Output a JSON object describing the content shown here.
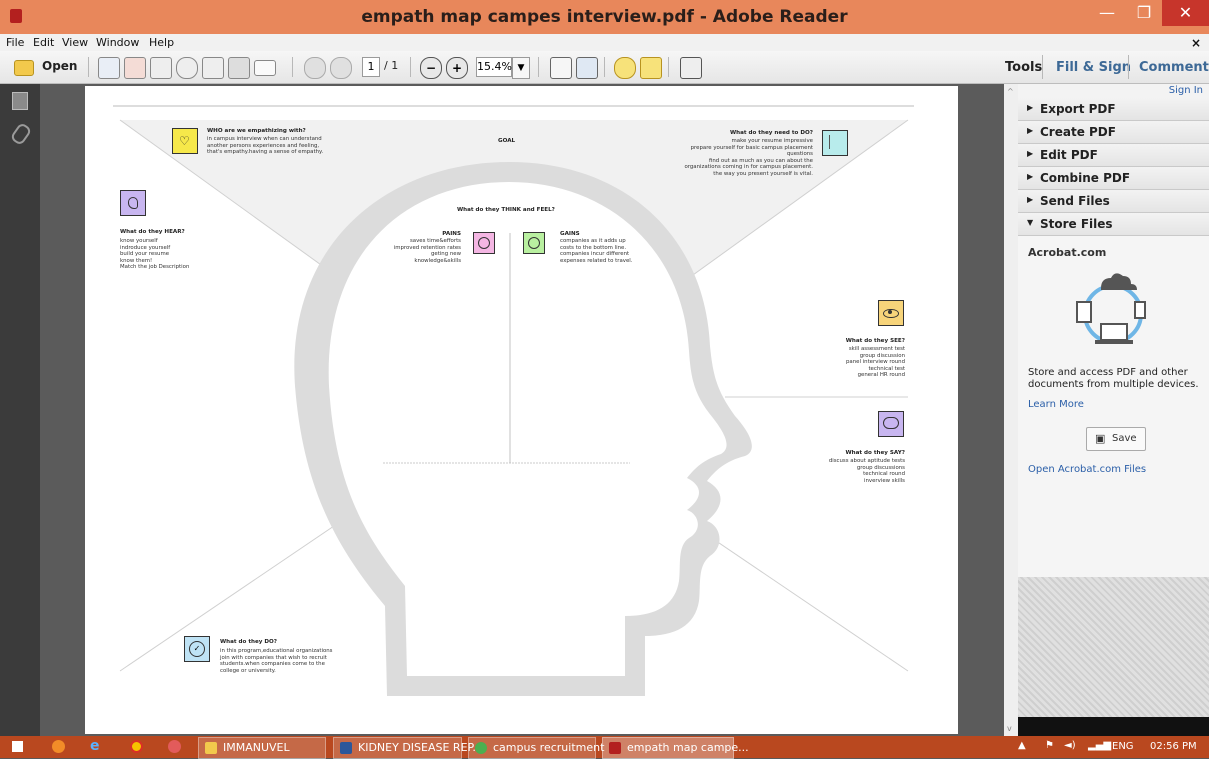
{
  "window": {
    "title": "empath map campes interview.pdf - Adobe Reader",
    "buttons": {
      "minimize": "—",
      "maximize": "❐",
      "close": "✕"
    }
  },
  "menu": [
    "File",
    "Edit",
    "View",
    "Window",
    "Help"
  ],
  "menu_close": "×",
  "toolbar": {
    "open_label": "Open",
    "page_current": "1",
    "page_total": "/ 1",
    "zoom": "15.4%",
    "tools_label": "Tools",
    "fill_sign_label": "Fill & Sign",
    "comment_label": "Comment"
  },
  "right_pane": {
    "sign_in": "Sign In",
    "panels": [
      "Export PDF",
      "Create PDF",
      "Edit PDF",
      "Combine PDF",
      "Send Files",
      "Store Files"
    ],
    "store": {
      "site": "Acrobat.com",
      "description": "Store and access PDF and other documents from multiple devices.",
      "learn_more": "Learn More",
      "save_label": "Save",
      "open_files": "Open Acrobat.com Files"
    }
  },
  "document": {
    "goal": "GOAL",
    "who": {
      "heading": "WHO are we empathizing with?",
      "lines": [
        "in campus interview when can understand",
        "another persons experiences and feeling,",
        "that's empathy.having a sense of empathy."
      ]
    },
    "do_need": {
      "heading": "What do they need to DO?",
      "lines": [
        "make your resume impressive",
        "prepare yourself for basic campus placement",
        "questions",
        "find out as much as  you can about the",
        "organizations coming in for campus placement.",
        "the way you  present  yourself is vital."
      ]
    },
    "hear": {
      "heading": "What do they HEAR?",
      "lines": [
        "know yourself",
        "indroduce  yourself",
        "build your resume",
        "know them!",
        "Match the job Description"
      ]
    },
    "think_feel": "What do they THINK and FEEL?",
    "pains": {
      "heading": "PAINS",
      "lines": [
        "saves time&efforts",
        "improved retention rates",
        "geting new",
        "knowledge&skills"
      ]
    },
    "gains": {
      "heading": "GAINS",
      "lines": [
        "companies as it adds up",
        "costs to the bottom line.",
        "companies incur different",
        "expenses related to travel."
      ]
    },
    "see": {
      "heading": "What do they SEE?",
      "lines": [
        "skill assessment test",
        "group discussion",
        "panel interview round",
        "technical test",
        "general HR round"
      ]
    },
    "say": {
      "heading": "What do they SAY?",
      "lines": [
        "discuss about  aptitude tests",
        "group discussions",
        "technical round",
        "inverview skills"
      ]
    },
    "do": {
      "heading": "What do they DO?",
      "lines": [
        "in this program,educational organizations",
        "join with companies that wish to recruit",
        "students.when companies come to the",
        "college or university."
      ]
    }
  },
  "taskbar": {
    "items": [
      "IMMANUVEL",
      "KIDNEY DISEASE REP...",
      "campus recruitment ...",
      "empath map campe..."
    ],
    "lang": "ENG",
    "time": "02:56 PM"
  },
  "colors": {
    "titlebar": "#e8875b",
    "taskbar": "#b9481f",
    "close_button": "#c7352b",
    "sticky_yellow": "#f6e84a",
    "sticky_purple": "#c8b6f0",
    "sticky_teal": "#b8ecec",
    "sticky_pink": "#f4b6e3",
    "sticky_green": "#b9f0a0",
    "sticky_orange": "#f7d47a",
    "sticky_blue": "#bfe3f5"
  }
}
